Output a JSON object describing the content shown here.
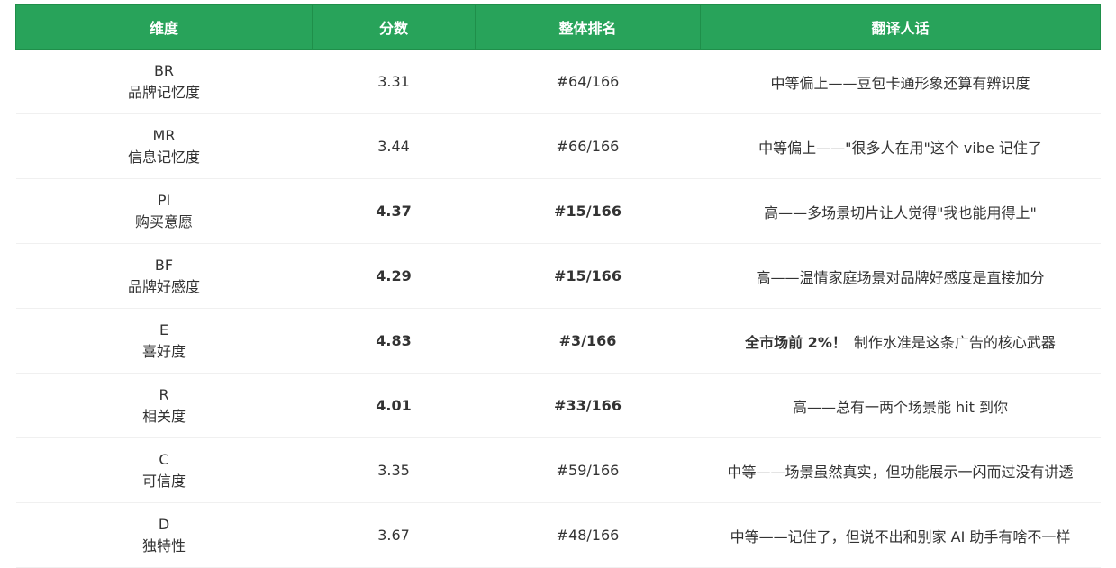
{
  "colors": {
    "header_bg": "#28a35a",
    "header_text": "#ffffff",
    "row_border": "#f0f0f0",
    "text": "#333333"
  },
  "table": {
    "headers": [
      "维度",
      "分数",
      "整体排名",
      "翻译人话"
    ],
    "rows": [
      {
        "code": "BR",
        "name": "品牌记忆度",
        "score": "3.31",
        "rank": "#64/166",
        "note": "中等偏上——豆包卡通形象还算有辨识度",
        "note_strong": "",
        "highlight": false
      },
      {
        "code": "MR",
        "name": "信息记忆度",
        "score": "3.44",
        "rank": "#66/166",
        "note": "中等偏上——\"很多人在用\"这个 vibe 记住了",
        "note_strong": "",
        "highlight": false
      },
      {
        "code": "PI",
        "name": "购买意愿",
        "score": "4.37",
        "rank": "#15/166",
        "note": "高——多场景切片让人觉得\"我也能用得上\"",
        "note_strong": "",
        "highlight": true
      },
      {
        "code": "BF",
        "name": "品牌好感度",
        "score": "4.29",
        "rank": "#15/166",
        "note": "高——温情家庭场景对品牌好感度是直接加分",
        "note_strong": "",
        "highlight": true
      },
      {
        "code": "E",
        "name": "喜好度",
        "score": "4.83",
        "rank": "#3/166",
        "note": "制作水准是这条广告的核心武器",
        "note_strong": "全市场前 2%！",
        "highlight": true
      },
      {
        "code": "R",
        "name": "相关度",
        "score": "4.01",
        "rank": "#33/166",
        "note": "高——总有一两个场景能 hit 到你",
        "note_strong": "",
        "highlight": true
      },
      {
        "code": "C",
        "name": "可信度",
        "score": "3.35",
        "rank": "#59/166",
        "note": "中等——场景虽然真实，但功能展示一闪而过没有讲透",
        "note_strong": "",
        "highlight": false
      },
      {
        "code": "D",
        "name": "独特性",
        "score": "3.67",
        "rank": "#48/166",
        "note": "中等——记住了，但说不出和别家 AI 助手有啥不一样",
        "note_strong": "",
        "highlight": false
      }
    ]
  }
}
